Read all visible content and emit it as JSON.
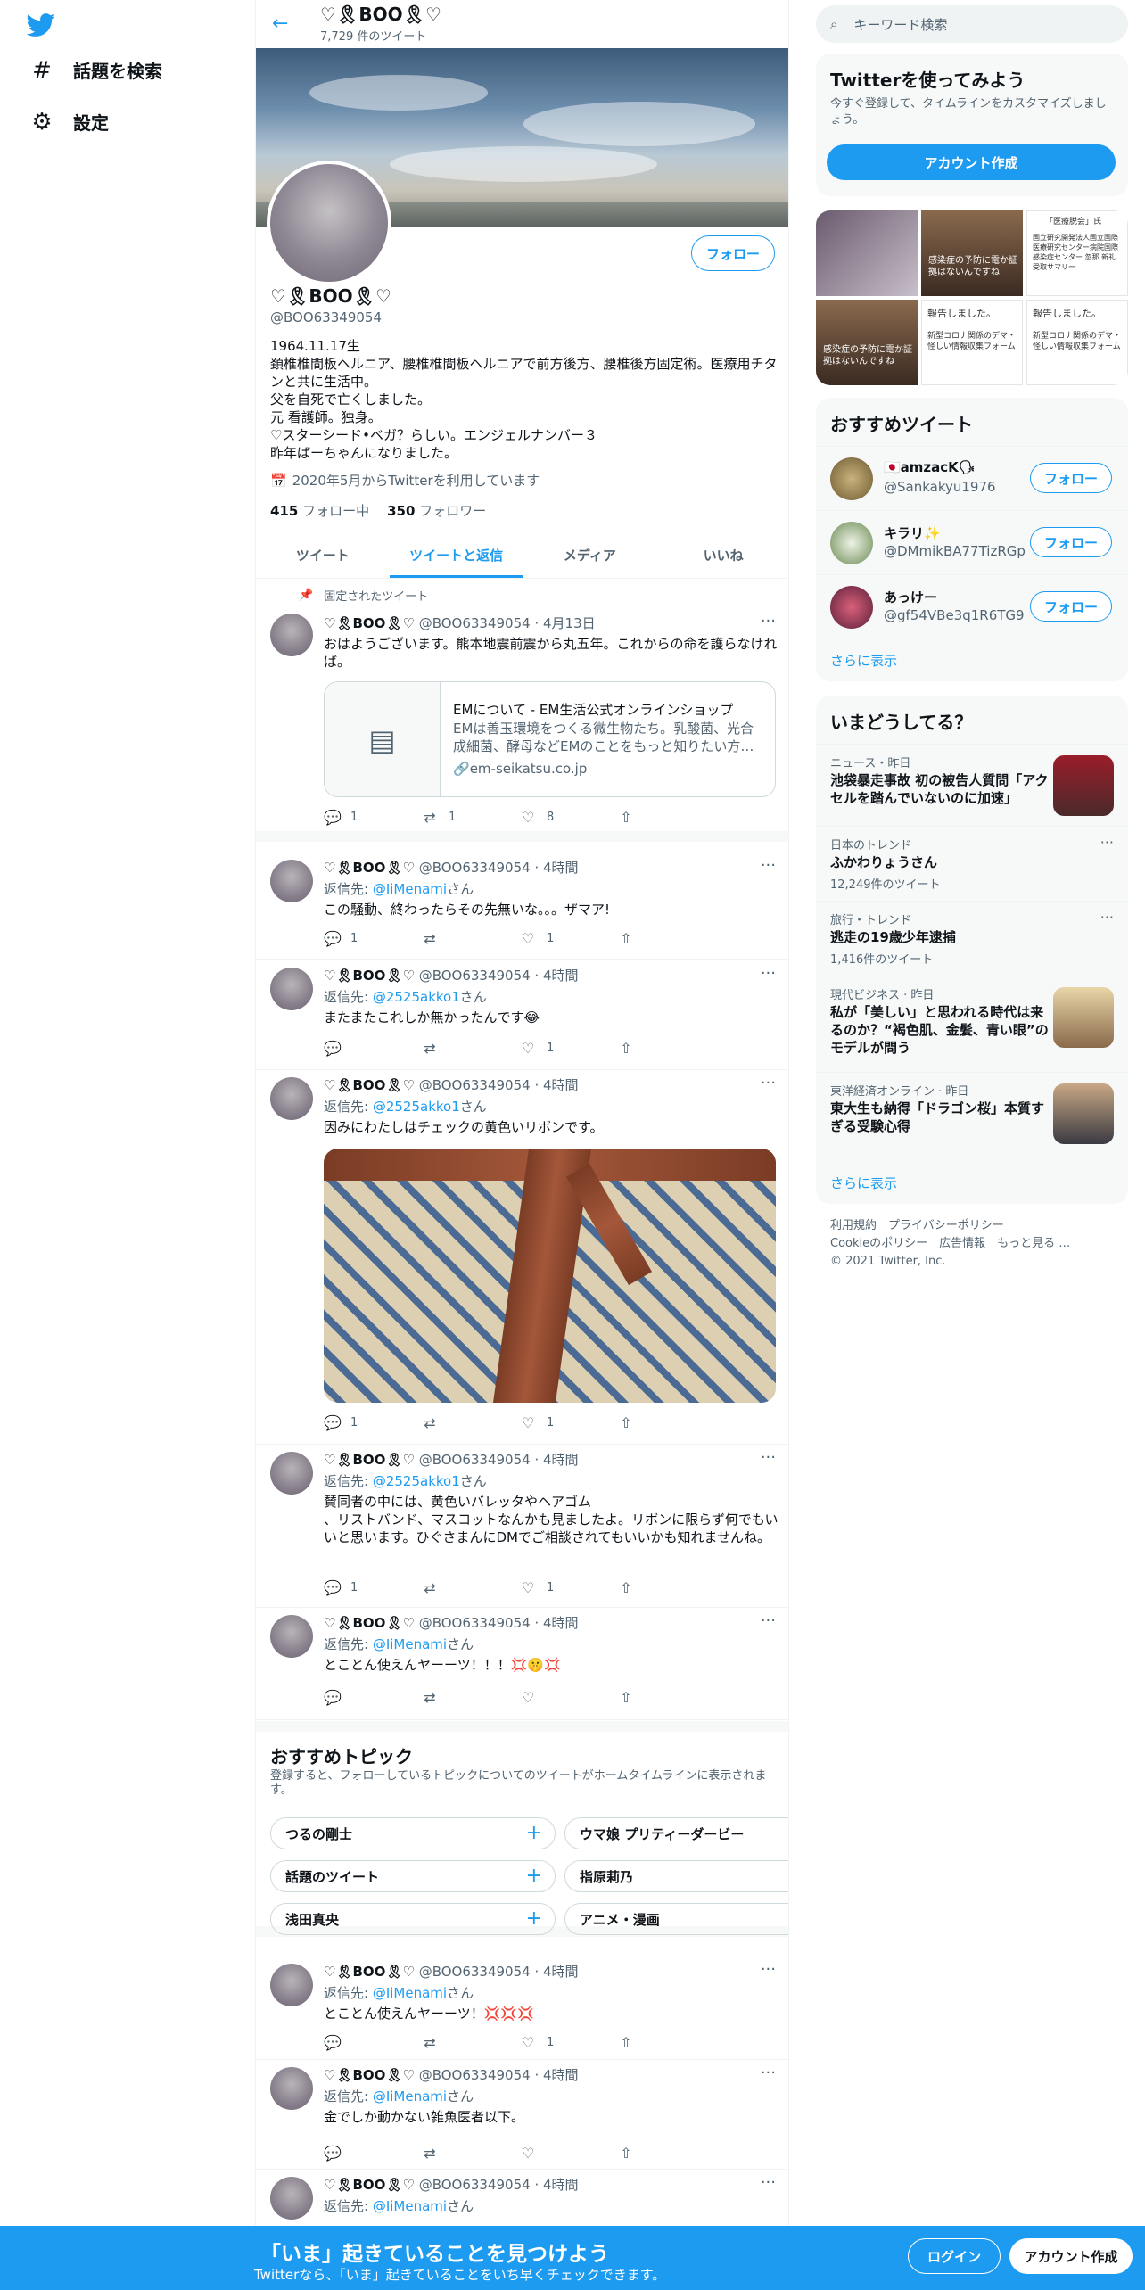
{
  "nav": {
    "explore": "話題を検索",
    "settings": "設定"
  },
  "profile": {
    "header_name": "♡🎗BOO🎗♡",
    "tweet_count": "7,729 件のツイート",
    "name": "♡🎗BOO🎗♡",
    "handle": "@BOO63349054",
    "follow_label": "フォロー",
    "bio": "1964.11.17生\n頚椎椎間板ヘルニア、腰椎椎間板ヘルニアで前方後方、腰椎後方固定術。医療用チタンと共に生活中。\n父を自死で亡くしました。\n元 看護師。独身。\n♡スターシード•ベガ？らしい。エンジェルナンバー３\n昨年ばーちゃんになりました。",
    "joined": "2020年5月からTwitterを利用しています",
    "following_count": "415",
    "following_label": "フォロー中",
    "followers_count": "350",
    "followers_label": "フォロワー"
  },
  "tabs": [
    "ツイート",
    "ツイートと返信",
    "メディア",
    "いいね"
  ],
  "tweets": [
    {
      "pinned": "固定されたツイート",
      "name": "♡🎗BOO🎗♡",
      "meta": "@BOO63349054 · 4月13日",
      "reply_to": "",
      "reply_suffix": "",
      "text": "おはようございます。熊本地震前震から丸五年。これからの命を護らなければ。",
      "card": {
        "title": "EMについて - EM生活公式オンラインショップ",
        "desc": "EMは善玉環境をつくる微生物たち。乳酸菌、光合成細菌、酵母などEMのことをもっと知りたい方…",
        "url": "em-seikatsu.co.jp"
      },
      "replies": "1",
      "retweets": "1",
      "likes": "8"
    },
    {
      "name": "♡🎗BOO🎗♡",
      "meta": "@BOO63349054 · 4時間",
      "reply_prefix": "返信先: ",
      "reply_to": "@IiMenami",
      "reply_suffix": "さん",
      "text": "この騒動、終わったらその先無いな。。。ザマア!",
      "replies": "1",
      "retweets": "",
      "likes": "1"
    },
    {
      "name": "♡🎗BOO🎗♡",
      "meta": "@BOO63349054 · 4時間",
      "reply_prefix": "返信先: ",
      "reply_to": "@2525akko1",
      "reply_suffix": "さん",
      "text": "またまたこれしか無かったんです😂",
      "replies": "",
      "retweets": "",
      "likes": "1"
    },
    {
      "name": "♡🎗BOO🎗♡",
      "meta": "@BOO63349054 · 4時間",
      "reply_prefix": "返信先: ",
      "reply_to": "@2525akko1",
      "reply_suffix": "さん",
      "text": "因みにわたしはチェックの黄色いリボンです。",
      "replies": "1",
      "retweets": "",
      "likes": "1"
    },
    {
      "name": "♡🎗BOO🎗♡",
      "meta": "@BOO63349054 · 4時間",
      "reply_prefix": "返信先: ",
      "reply_to": "@2525akko1",
      "reply_suffix": "さん",
      "text": "賛同者の中には、黄色いバレッタやヘアゴム\n、リストバンド、マスコットなんかも見ましたよ。リボンに限らず何でもいいと思います。ひぐさまんにDMでご相談されてもいいかも知れませんね。",
      "replies": "1",
      "retweets": "",
      "likes": "1"
    },
    {
      "name": "♡🎗BOO🎗♡",
      "meta": "@BOO63349054 · 4時間",
      "reply_prefix": "返信先: ",
      "reply_to": "@IiMenami",
      "reply_suffix": "さん",
      "text": "とことん使えんヤーーツ！！！💢🤫💢",
      "replies": "",
      "retweets": "",
      "likes": ""
    },
    {
      "name": "♡🎗BOO🎗♡",
      "meta": "@BOO63349054 · 4時間",
      "reply_prefix": "返信先: ",
      "reply_to": "@IiMenami",
      "reply_suffix": "さん",
      "text": "とことん使えんヤーーツ！💢💢💢",
      "replies": "",
      "retweets": "",
      "likes": "1"
    },
    {
      "name": "♡🎗BOO🎗♡",
      "meta": "@BOO63349054 · 4時間",
      "reply_prefix": "返信先: ",
      "reply_to": "@IiMenami",
      "reply_suffix": "さん",
      "text": "金でしか動かない雑魚医者以下。",
      "replies": "",
      "retweets": "",
      "likes": ""
    },
    {
      "name": "♡🎗BOO🎗♡",
      "meta": "@BOO63349054 · 4時間",
      "reply_prefix": "返信先: ",
      "reply_to": "@IiMenami",
      "reply_suffix": "さん",
      "text": "",
      "replies": "",
      "retweets": "",
      "likes": ""
    }
  ],
  "topics": {
    "title": "おすすめトピック",
    "sub": "登録すると、フォローしているトピックについてのツイートがホームタイムラインに表示されます。",
    "chips": [
      "つるの剛士",
      "ウマ娘 プリティーダービー",
      "話題のツイート",
      "指原莉乃",
      "浅田真央",
      "アニメ・漫画"
    ]
  },
  "search": {
    "placeholder": "キーワード検索"
  },
  "signup": {
    "title": "Twitterを使ってみよう",
    "desc": "今すぐ登録して、タイムラインをカスタマイズしましょう。",
    "button": "アカウント作成"
  },
  "media_texts": {
    "t1": "感染症の予防に電か証拠はないんですね",
    "t2": "「医療脱会」氏",
    "t3": "国立研究開発法人国立国際医療研究センター病院国際感染症センター 忽那 新礼受取サマリー",
    "t4": "報告しました。",
    "t5": "新型コロナ関係のデマ・怪しい情報収集フォーム"
  },
  "suggest": {
    "title": "おすすめツイート",
    "users": [
      {
        "name": "🇯🇵amzacK🗣",
        "handle": "@Sankakyu1976"
      },
      {
        "name": "キラリ✨",
        "handle": "@DMmikBA77TizRGp"
      },
      {
        "name": "あっけー",
        "handle": "@gf54VBe3q1R6TG9"
      }
    ],
    "follow_label": "フォロー",
    "more": "さらに表示"
  },
  "trends": {
    "title": "いまどうしてる？",
    "items": [
      {
        "cat": "ニュース・昨日",
        "title": "池袋暴走事故 初の被告人質問「アクセルを踏んでいないのに加速」",
        "count": ""
      },
      {
        "cat": "日本のトレンド",
        "title": "ふかわりょうさん",
        "count": "12,249件のツイート"
      },
      {
        "cat": "旅行・トレンド",
        "title": "逃走の19歳少年逮捕",
        "count": "1,416件のツイート"
      },
      {
        "cat": "現代ビジネス · 昨日",
        "title": "私が「美しい」と思われる時代は来るのか？“褐色肌、金髪、青い眼”のモデルが問う",
        "count": ""
      },
      {
        "cat": "東洋経済オンライン · 昨日",
        "title": "東大生も納得「ドラゴン桜」本質すぎる受験心得",
        "count": ""
      }
    ],
    "more": "さらに表示"
  },
  "footer": {
    "line1": "利用規約　プライバシーポリシー",
    "line2": "Cookieのポリシー　広告情報　もっと見る …",
    "line3": "© 2021 Twitter, Inc."
  },
  "bottombar": {
    "title": "「いま」起きていることを見つけよう",
    "sub": "Twitterなら、「いま」起きていることをいち早くチェックできます。",
    "login": "ログイン",
    "signup": "アカウント作成"
  }
}
